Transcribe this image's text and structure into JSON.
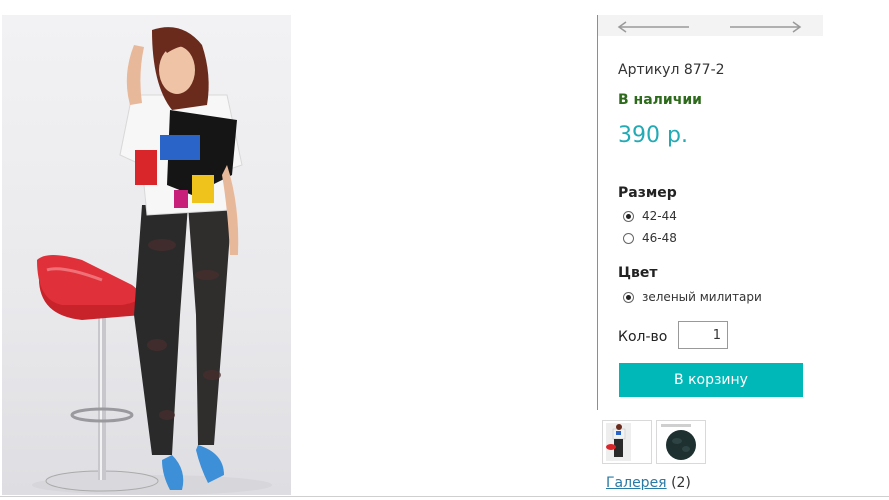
{
  "product": {
    "sku": "Артикул 877-2",
    "stock": "В наличии",
    "price": "390 р."
  },
  "options": {
    "size": {
      "title": "Размер",
      "items": [
        {
          "label": "42-44",
          "selected": true
        },
        {
          "label": "46-48",
          "selected": false
        }
      ]
    },
    "color": {
      "title": "Цвет",
      "items": [
        {
          "label": "зеленый милитари",
          "selected": true
        }
      ]
    }
  },
  "quantity": {
    "label": "Кол-во",
    "value": "1"
  },
  "cart_button": "В корзину",
  "gallery": {
    "link": "Галерея",
    "count": "(2)"
  },
  "icons": {
    "prev": "arrow-left-icon",
    "next": "arrow-right-icon"
  },
  "colors": {
    "accent": "#2bb7c2",
    "button": "#00b8b8",
    "price": "#22aab5",
    "in_stock": "#2d6a1b",
    "link": "#2a7aa6"
  }
}
